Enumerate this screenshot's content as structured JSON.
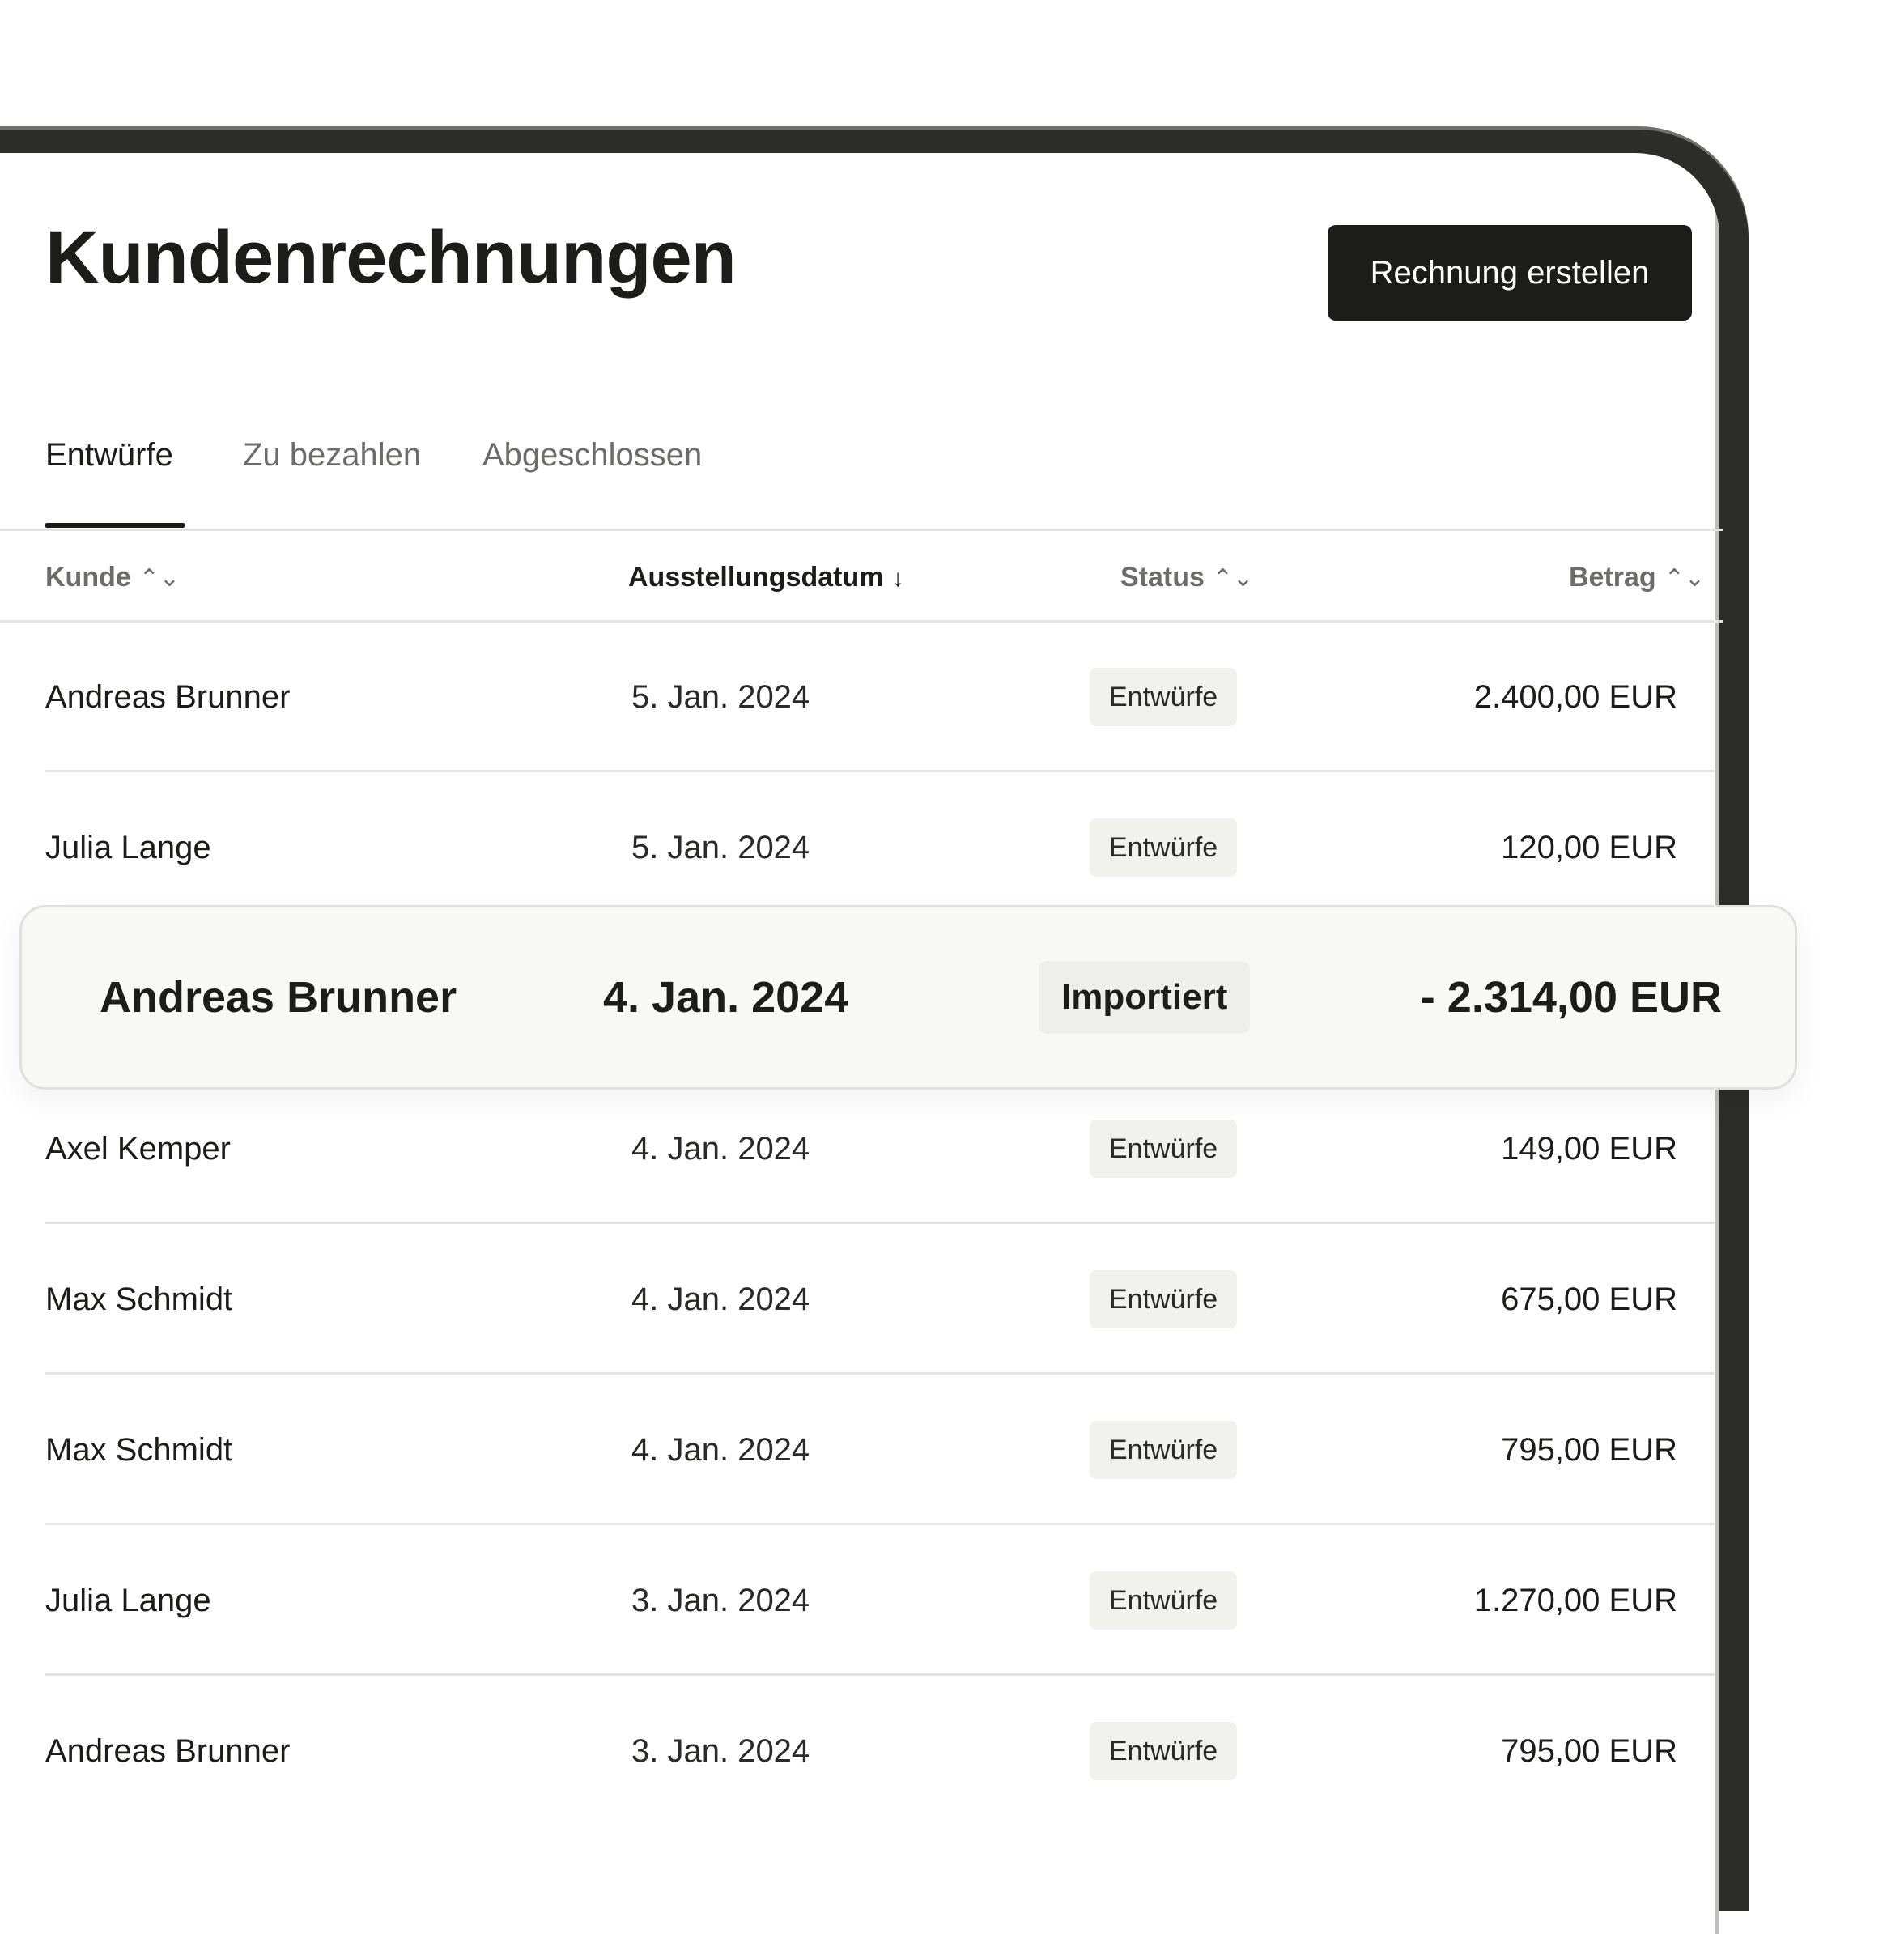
{
  "header": {
    "title": "Kundenrechnungen",
    "create_button": "Rechnung erstellen"
  },
  "tabs": [
    {
      "label": "Entwürfe",
      "active": true
    },
    {
      "label": "Zu bezahlen",
      "active": false
    },
    {
      "label": "Abgeschlossen",
      "active": false
    }
  ],
  "table": {
    "columns": {
      "kunde": "Kunde",
      "datum": "Ausstellungsdatum",
      "status": "Status",
      "betrag": "Betrag"
    },
    "sort_icons": {
      "unsorted": "⌃⌄",
      "descending": "↓"
    },
    "rows": [
      {
        "kunde": "Andreas Brunner",
        "datum": "5. Jan. 2024",
        "status": "Entwürfe",
        "betrag": "2.400,00 EUR"
      },
      {
        "kunde": "Julia Lange",
        "datum": "5. Jan. 2024",
        "status": "Entwürfe",
        "betrag": "120,00 EUR"
      },
      {
        "kunde": "Axel Kemper",
        "datum": "4. Jan. 2024",
        "status": "Entwürfe",
        "betrag": "149,00 EUR"
      },
      {
        "kunde": "Max Schmidt",
        "datum": "4. Jan. 2024",
        "status": "Entwürfe",
        "betrag": "675,00 EUR"
      },
      {
        "kunde": "Max Schmidt",
        "datum": "4. Jan. 2024",
        "status": "Entwürfe",
        "betrag": "795,00 EUR"
      },
      {
        "kunde": "Julia Lange",
        "datum": "3. Jan. 2024",
        "status": "Entwürfe",
        "betrag": "1.270,00 EUR"
      },
      {
        "kunde": "Andreas Brunner",
        "datum": "3. Jan. 2024",
        "status": "Entwürfe",
        "betrag": "795,00 EUR"
      }
    ]
  },
  "highlight": {
    "kunde": "Andreas Brunner",
    "datum": "4. Jan. 2024",
    "status": "Importiert",
    "betrag": "- 2.314,00 EUR"
  },
  "colors": {
    "text": "#1c1c1a",
    "muted": "#6c6c6a",
    "button_bg": "#1c1c1a",
    "badge_bg": "#f1f1ee",
    "frame": "#2c2c2a"
  }
}
